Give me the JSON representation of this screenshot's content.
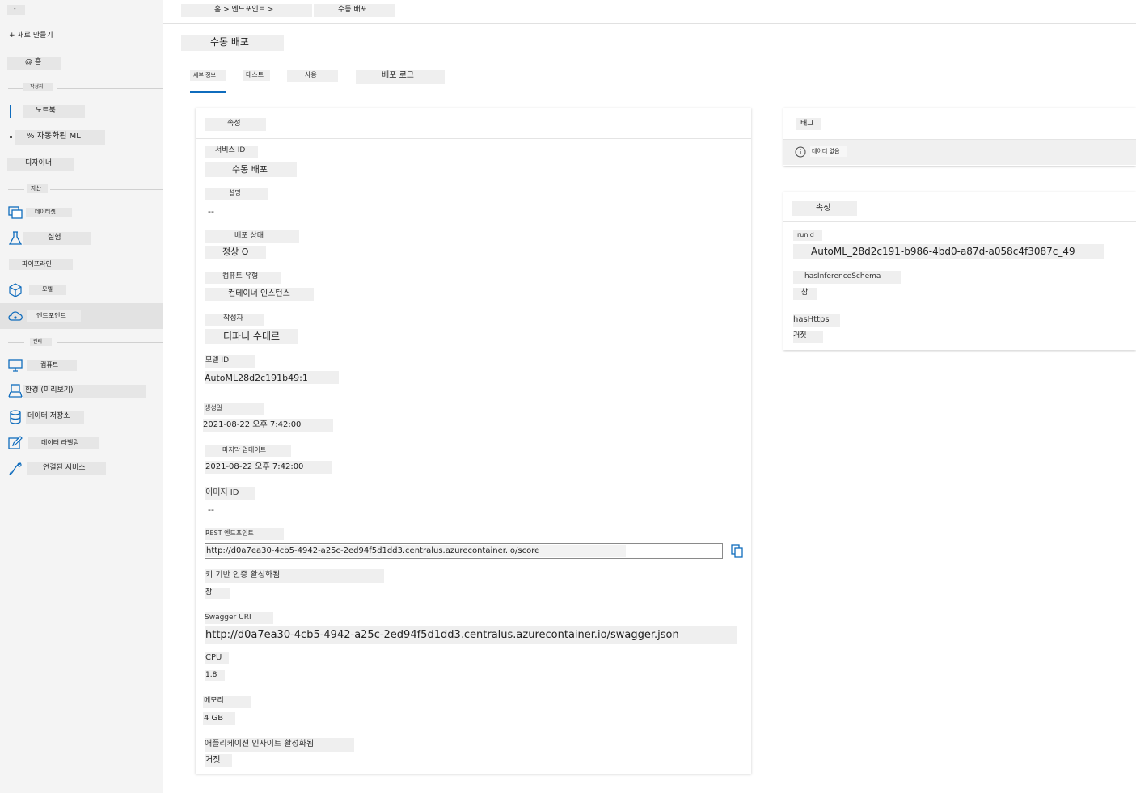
{
  "sidebar": {
    "top_label": "-",
    "new_button": "+ 새로 만들기",
    "home": "@ 홈",
    "section_author": "작성자",
    "notebook": "노트북",
    "automl": "% 자동화된 ML",
    "designer": "디자이너",
    "section_assets": "자산",
    "datasets": "데이터셋",
    "experiments": "실험",
    "pipelines": "파이프라인",
    "models": "모델",
    "endpoints": "엔드포인트",
    "section_manage": "관리",
    "compute": "컴퓨트",
    "environments": "환경 (미리보기)",
    "datastores": "데이터 저장소",
    "data_labeling": "데이터 라벨링",
    "linked_services": "연결된 서비스"
  },
  "breadcrumb": {
    "path": "홈 > 엔드포인트 >",
    "current": "수동 배포"
  },
  "page_title": "수동 배포",
  "tabs": {
    "details": "세부 정보",
    "test": "테스트",
    "consume": "사용",
    "logs": "배포 로그"
  },
  "attributes": {
    "title": "속성",
    "service_id_label": "서비스 ID",
    "service_id": "수동 배포",
    "description_label": "설명",
    "description": "--",
    "deploy_state_label": "배포 상태",
    "deploy_state": "정상 O",
    "compute_type_label": "컴퓨트 유형",
    "compute_type": "컨테이너 인스턴스",
    "created_by_label": "작성자",
    "created_by": "티파니 수테르",
    "model_id_label": "모델 ID",
    "model_id": "AutoML28d2c191b49:1",
    "created_on_label": "생성일",
    "created_on": "2021-08-22 오후 7:42:00",
    "last_updated_label": "마지막 업데이트",
    "last_updated": "2021-08-22 오후 7:42:00",
    "image_id_label": "이미지 ID",
    "image_id": "--",
    "rest_endpoint_label": "REST 엔드포인트",
    "rest_endpoint": "http://d0a7ea30-4cb5-4942-a25c-2ed94f5d1dd3.centralus.azurecontainer.io/score",
    "key_auth_label": "키 기반 인증 활성화됨",
    "key_auth": "참",
    "swagger_label": "Swagger URI",
    "swagger": "http://d0a7ea30-4cb5-4942-a25c-2ed94f5d1dd3.centralus.azurecontainer.io/swagger.json",
    "cpu_label": "CPU",
    "cpu": "1.8",
    "memory_label": "메모리",
    "memory": "4 GB",
    "app_insights_label": "애플리케이션 인사이트 활성화됨",
    "app_insights": "거짓"
  },
  "tags": {
    "title": "태그",
    "empty": "데이터 없음"
  },
  "properties": {
    "title": "속성",
    "runid_label": "runId",
    "runid": "AutoML_28d2c191-b986-4bd0-a87d-a058c4f3087c_49",
    "has_schema_label": "hasInferenceSchema",
    "has_schema": "참",
    "has_https_label": "hasHttps",
    "has_https": "거짓"
  },
  "colors": {
    "accent": "#0f6cbd",
    "sidebar_bg": "#f4f4f4",
    "selected_bg": "#e2e2e2"
  },
  "icons": [
    "dataset-icon",
    "flask-icon",
    "cube-icon",
    "cloud-endpoint-icon",
    "monitor-icon",
    "environment-icon",
    "database-icon",
    "edit-icon",
    "link-icon",
    "info-icon",
    "copy-icon"
  ]
}
